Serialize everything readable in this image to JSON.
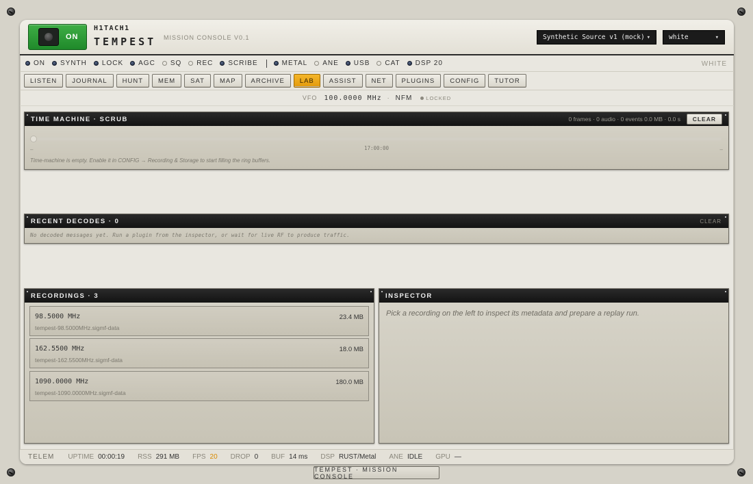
{
  "power": {
    "label": "ON"
  },
  "brand": {
    "top": "H1TACH1",
    "main": "TEMPEST",
    "subtitle": "MISSION CONSOLE V0.1"
  },
  "source_select": {
    "value": "Synthetic Source v1 (mock)"
  },
  "theme_select": {
    "value": "white"
  },
  "indicators": [
    {
      "label": "ON",
      "on": true
    },
    {
      "label": "SYNTH",
      "on": true
    },
    {
      "label": "LOCK",
      "on": true
    },
    {
      "label": "AGC",
      "on": true
    },
    {
      "label": "SQ",
      "on": false
    },
    {
      "label": "REC",
      "on": false
    },
    {
      "label": "SCRIBE",
      "on": true
    },
    {
      "label": "METAL",
      "on": true
    },
    {
      "label": "ANE",
      "on": false
    },
    {
      "label": "USB",
      "on": true
    },
    {
      "label": "CAT",
      "on": false
    },
    {
      "label": "DSP 20",
      "on": true
    }
  ],
  "theme_label": "WHITE",
  "tabs": [
    {
      "label": "LISTEN"
    },
    {
      "label": "JOURNAL"
    },
    {
      "label": "HUNT"
    },
    {
      "label": "MEM"
    },
    {
      "label": "SAT"
    },
    {
      "label": "MAP"
    },
    {
      "label": "ARCHIVE"
    },
    {
      "label": "LAB",
      "active": true
    },
    {
      "label": "ASSIST"
    },
    {
      "label": "NET"
    },
    {
      "label": "PLUGINS"
    },
    {
      "label": "CONFIG"
    },
    {
      "label": "TUTOR"
    }
  ],
  "vfo": {
    "label": "VFO",
    "freq": "100.0000 MHz",
    "dot": "·",
    "mode": "NFM",
    "lock": "LOCKED"
  },
  "time_machine": {
    "title": "TIME MACHINE · SCRUB",
    "meta": "0 frames · 0 audio · 0 events   0.0 MB · 0.0 s",
    "clear": "CLEAR",
    "left": "–",
    "time": "17:00:00",
    "right": "–",
    "note": "Time-machine is empty. Enable it in CONFIG → Recording & Storage to start filling the ring buffers."
  },
  "recent_decodes": {
    "title": "RECENT DECODES · 0",
    "clear": "CLEAR",
    "note": "No decoded messages yet. Run a plugin from the inspector, or wait for live RF to produce traffic."
  },
  "recordings": {
    "title": "RECORDINGS · 3",
    "items": [
      {
        "freq": "98.5000 MHz",
        "size": "23.4 MB",
        "file": "tempest-98.5000MHz.sigmf-data"
      },
      {
        "freq": "162.5500 MHz",
        "size": "18.0 MB",
        "file": "tempest-162.5500MHz.sigmf-data"
      },
      {
        "freq": "1090.0000 MHz",
        "size": "180.0 MB",
        "file": "tempest-1090.0000MHz.sigmf-data"
      }
    ]
  },
  "inspector": {
    "title": "INSPECTOR",
    "placeholder": "Pick a recording on the left to inspect its metadata and prepare a replay run."
  },
  "telemetry": {
    "label": "TELEM",
    "uptime_label": "UPTIME",
    "uptime": "00:00:19",
    "rss_label": "RSS",
    "rss": "291 MB",
    "fps_label": "FPS",
    "fps": "20",
    "drop_label": "DROP",
    "drop": "0",
    "buf_label": "BUF",
    "buf": "14 ms",
    "dsp_label": "DSP",
    "dsp": "RUST/Metal",
    "ane_label": "ANE",
    "ane": "IDLE",
    "gpu_label": "GPU",
    "gpu": "—"
  },
  "footer_tag": "TEMPEST · MISSION CONSOLE"
}
